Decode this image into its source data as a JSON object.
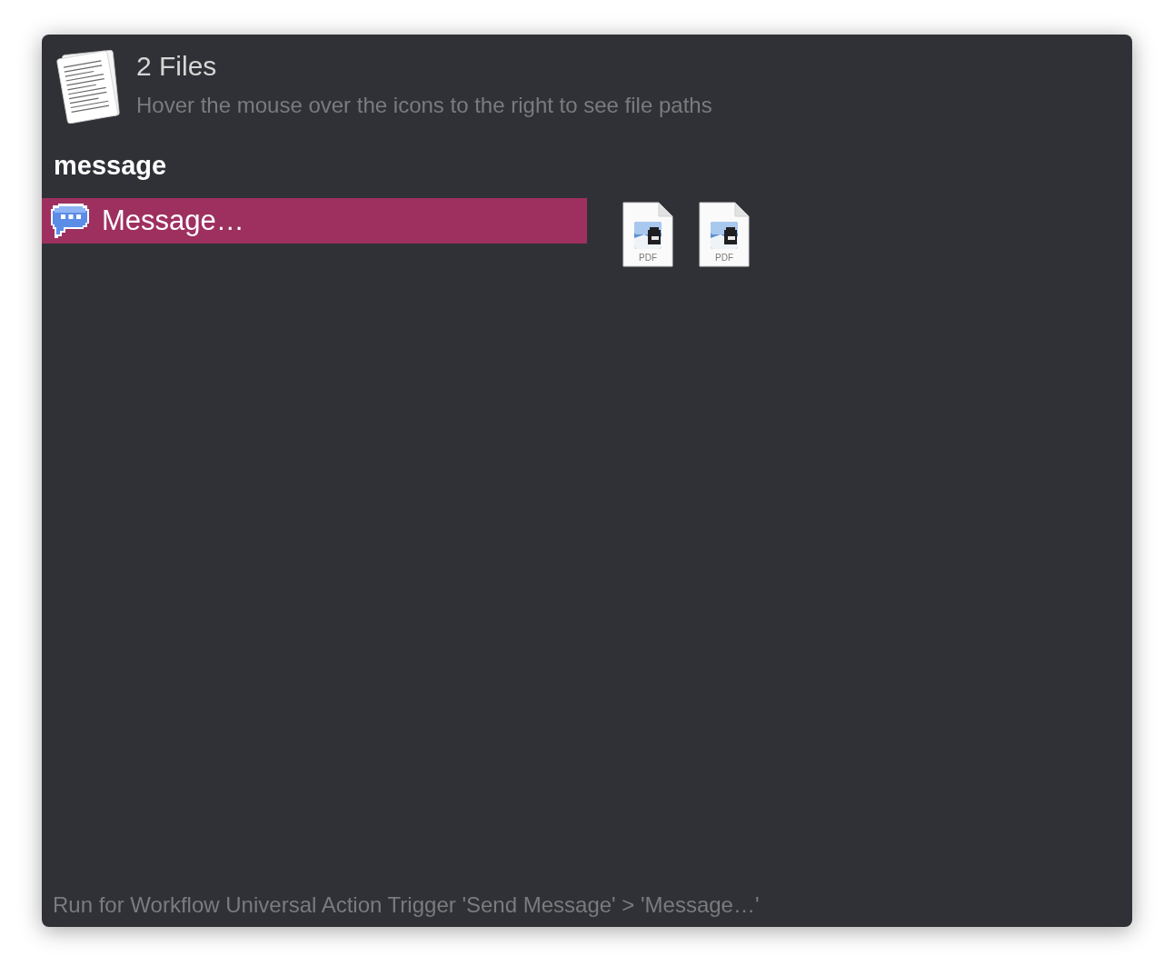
{
  "header": {
    "title": "2 Files",
    "subtitle": "Hover the mouse over the icons to the right to see file paths"
  },
  "query": "message",
  "results": [
    {
      "label": "Message…",
      "selected": true
    }
  ],
  "files": [
    {
      "label": "PDF"
    },
    {
      "label": "PDF"
    }
  ],
  "footer": "Run for Workflow Universal Action Trigger 'Send Message' > 'Message…'"
}
